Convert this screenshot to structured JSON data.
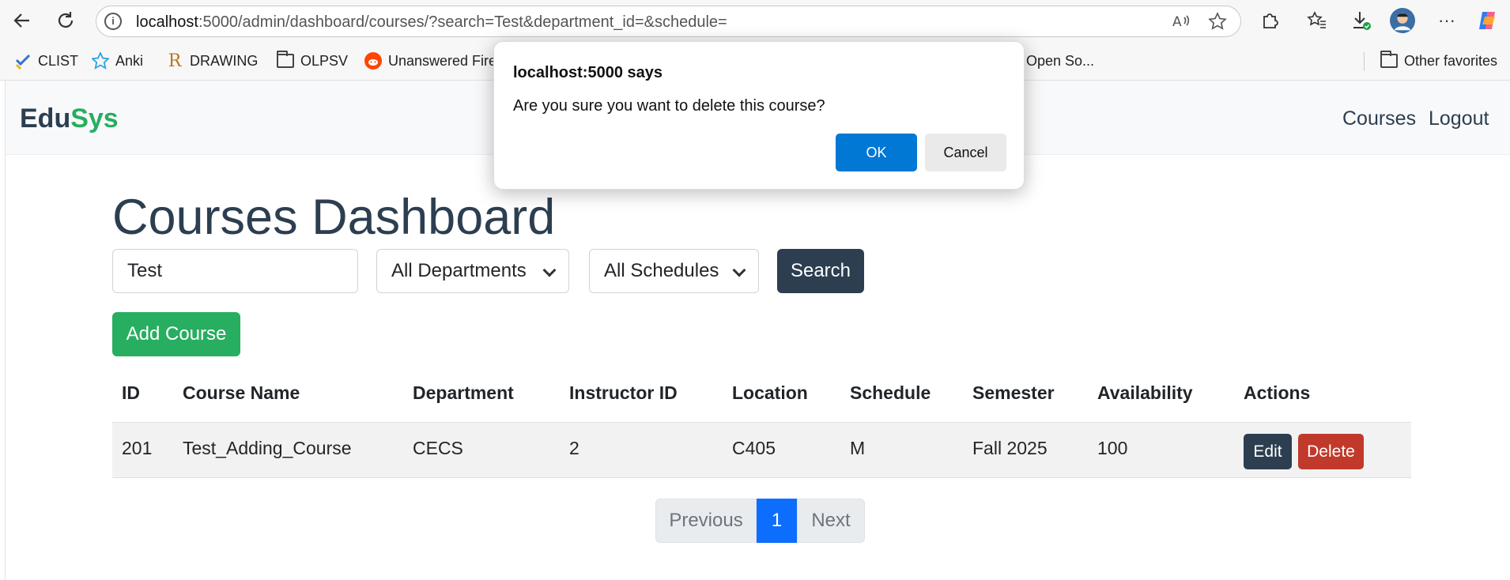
{
  "browser": {
    "address_host": "localhost",
    "address_rest": ":5000/admin/dashboard/courses/?search=Test&department_id=&schedule=",
    "bookmarks": [
      "CLIST",
      "Anki",
      "DRAWING",
      "OLPSV",
      "Unanswered Fire",
      "Open So...",
      "Other favorites"
    ]
  },
  "navbar": {
    "brand_part1": "Edu",
    "brand_part2": "Sys",
    "links": [
      "Courses",
      "Logout"
    ]
  },
  "main": {
    "title": "Courses Dashboard",
    "search_value": "Test",
    "department_select": "All Departments",
    "schedule_select": "All Schedules",
    "search_button": "Search",
    "add_button": "Add Course"
  },
  "table": {
    "headers": [
      "ID",
      "Course Name",
      "Department",
      "Instructor ID",
      "Location",
      "Schedule",
      "Semester",
      "Availability",
      "Actions"
    ],
    "rows": [
      {
        "cells": [
          "201",
          "Test_Adding_Course",
          "CECS",
          "2",
          "C405",
          "M",
          "Fall 2025",
          "100"
        ],
        "edit": "Edit",
        "delete": "Delete"
      }
    ]
  },
  "pagination": {
    "prev": "Previous",
    "current": "1",
    "next": "Next"
  },
  "dialog": {
    "title": "localhost:5000 says",
    "message": "Are you sure you want to delete this course?",
    "ok": "OK",
    "cancel": "Cancel"
  },
  "colors": {
    "primary_dark": "#2c3e50",
    "success": "#27ae60",
    "danger": "#c0392b",
    "page_active": "#0d6efd",
    "dialog_ok": "#0078d4"
  }
}
